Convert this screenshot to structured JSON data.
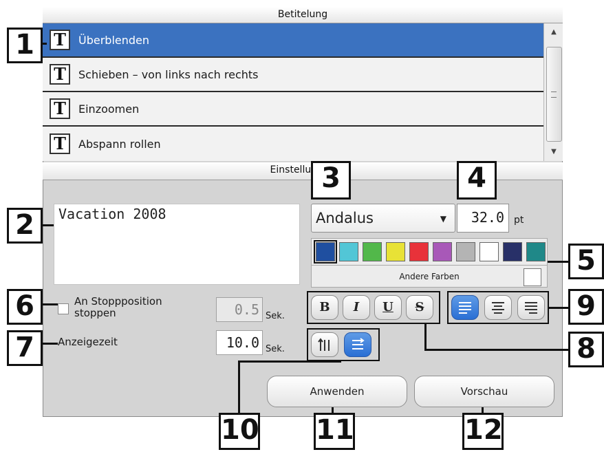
{
  "titling": {
    "header": "Betitelung",
    "items": [
      {
        "label": "Überblenden",
        "selected": true
      },
      {
        "label": "Schieben – von links nach rechts",
        "selected": false
      },
      {
        "label": "Einzoomen",
        "selected": false
      },
      {
        "label": "Abspann rollen",
        "selected": false
      }
    ]
  },
  "settings": {
    "header": "Einstellungen",
    "text_value": "Vacation 2008",
    "font_name": "Andalus",
    "font_size": "32.0",
    "font_size_unit": "pt",
    "colors": [
      "#1f4fa0",
      "#52c6d6",
      "#52b84a",
      "#e8e236",
      "#e8323a",
      "#a858b8",
      "#b4b4b4",
      "#ffffff",
      "#283068",
      "#1f8888"
    ],
    "other_colors_label": "Andere Farben",
    "stop_position_label": "An Stoppposition stoppen",
    "stop_value": "0.5",
    "display_time_label": "Anzeigezeit",
    "display_time_value": "10.0",
    "unit_sek": "Sek.",
    "apply_label": "Anwenden",
    "preview_label": "Vorschau"
  },
  "style_buttons": {
    "bold": "B",
    "italic": "I",
    "underline": "U",
    "strike": "S"
  },
  "callouts": [
    "1",
    "2",
    "3",
    "4",
    "5",
    "6",
    "7",
    "8",
    "9",
    "10",
    "11",
    "12"
  ]
}
